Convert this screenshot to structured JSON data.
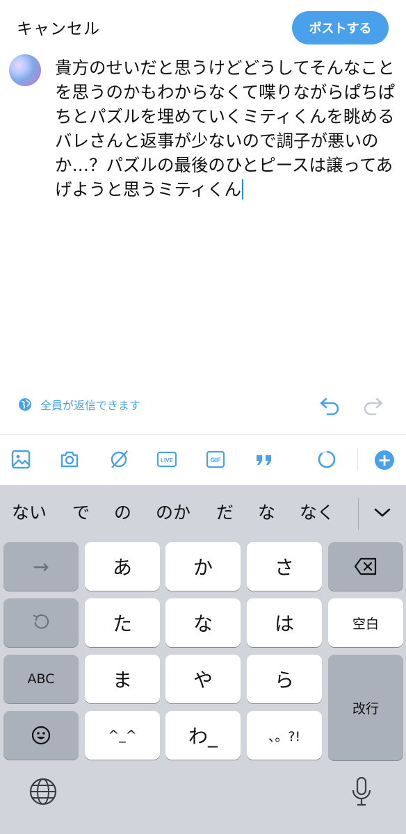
{
  "header": {
    "cancel_label": "キャンセル",
    "post_label": "ポストする"
  },
  "composer": {
    "text": "貴方のせいだと思うけどどうしてそんなことを思うのかもわからなくて喋りながらぱちぱちとパズルを埋めていくミティくんを眺めるバレさんと返事が少ないので調子が悪いのか…？パズルの最後のひとピースは譲ってあげようと思うミティくん"
  },
  "reply_setting": {
    "label": "全員が返信できます",
    "icon": "globe-icon"
  },
  "toolbar": {
    "items": [
      "image-icon",
      "camera-icon",
      "no-circle-icon",
      "live-icon",
      "gif-icon",
      "quote-icon",
      "progress-ring-icon",
      "add-icon"
    ],
    "live_label": "LIVE",
    "gif_label": "GIF",
    "plus_label": "+"
  },
  "keyboard": {
    "candidates": [
      "ない",
      "で",
      "の",
      "のか",
      "だ",
      "な",
      "なく"
    ],
    "keys": {
      "arrow": "→",
      "a": "あ",
      "ka": "か",
      "sa": "さ",
      "ta": "た",
      "na": "な",
      "ha": "は",
      "space": "空白",
      "abc": "ABC",
      "ma": "ま",
      "ya": "や",
      "ra": "ら",
      "enter": "改行",
      "emoticon": "^_^",
      "wa": "わ_",
      "punct": "、。?!"
    }
  },
  "colors": {
    "accent": "#4aa1eb",
    "keyboard_bg": "#d1d4db",
    "dark_key": "#abb1bb"
  }
}
